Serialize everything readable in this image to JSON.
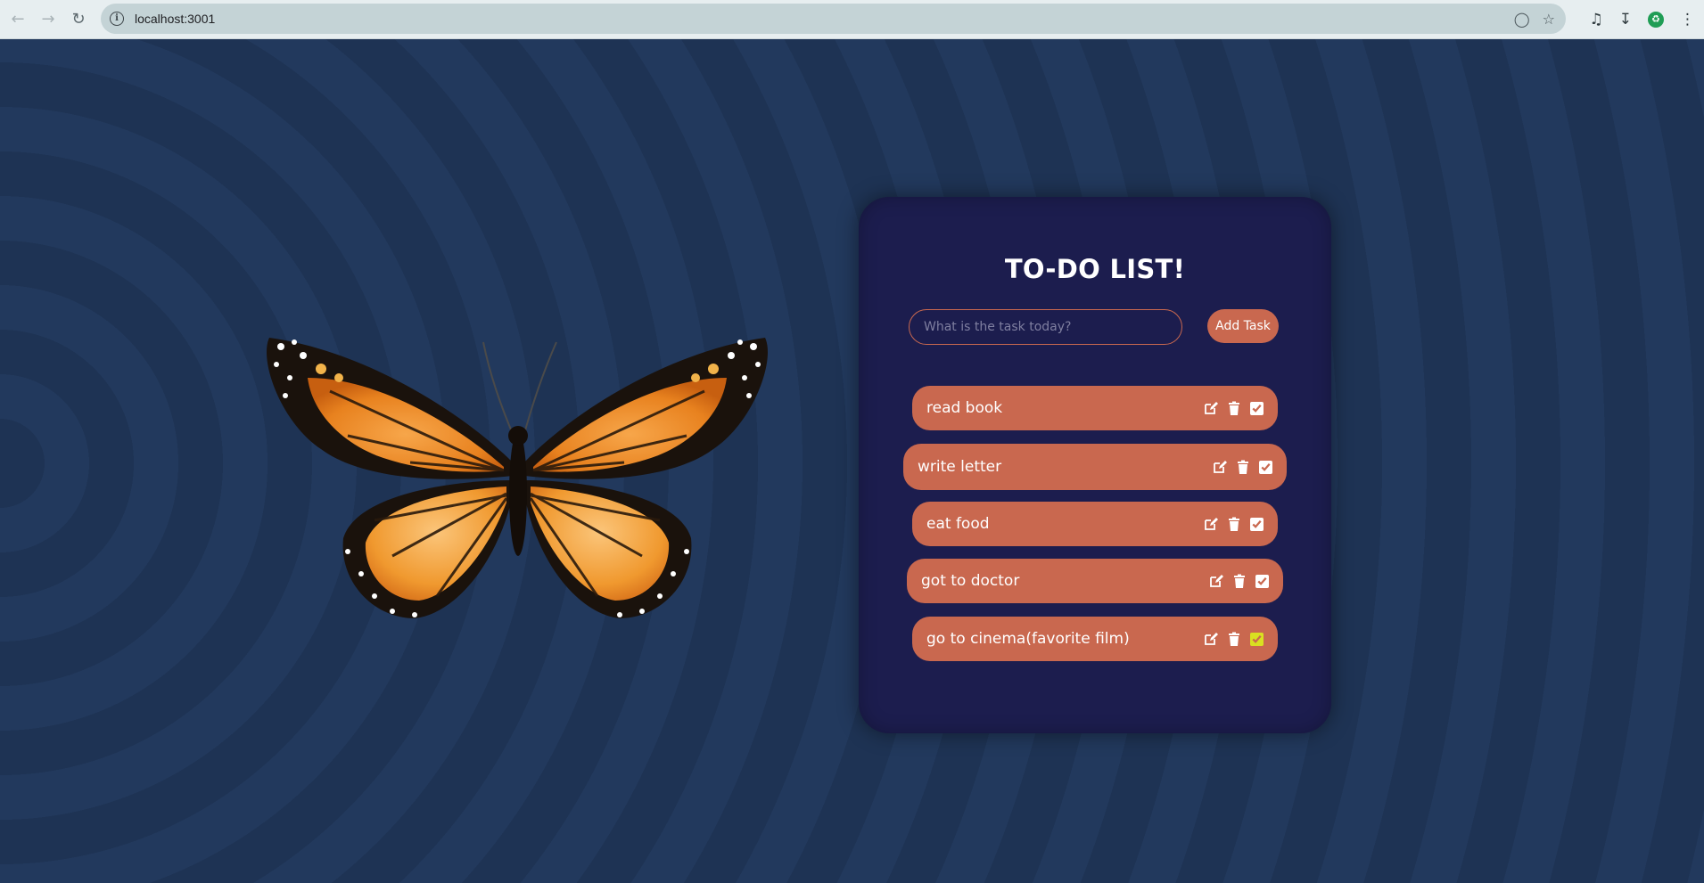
{
  "browser": {
    "back_icon": "back-arrow-icon",
    "forward_icon": "forward-arrow-icon",
    "reload_icon": "reload-icon",
    "url": "localhost:3001"
  },
  "app": {
    "title": "TO-DO LIST!",
    "input_placeholder": "What is the task today?",
    "add_button_label": "Add Task",
    "tasks": [
      {
        "label": "read book",
        "checked": false
      },
      {
        "label": "write letter",
        "checked": false
      },
      {
        "label": "eat food",
        "checked": false
      },
      {
        "label": "got to doctor",
        "checked": false
      },
      {
        "label": "go to cinema(favorite film)",
        "checked": true
      }
    ]
  },
  "colors": {
    "accent": "#c9684f",
    "card": "#1c1d4e",
    "background": "#1e3354",
    "checked_highlight": "#d9e021"
  }
}
